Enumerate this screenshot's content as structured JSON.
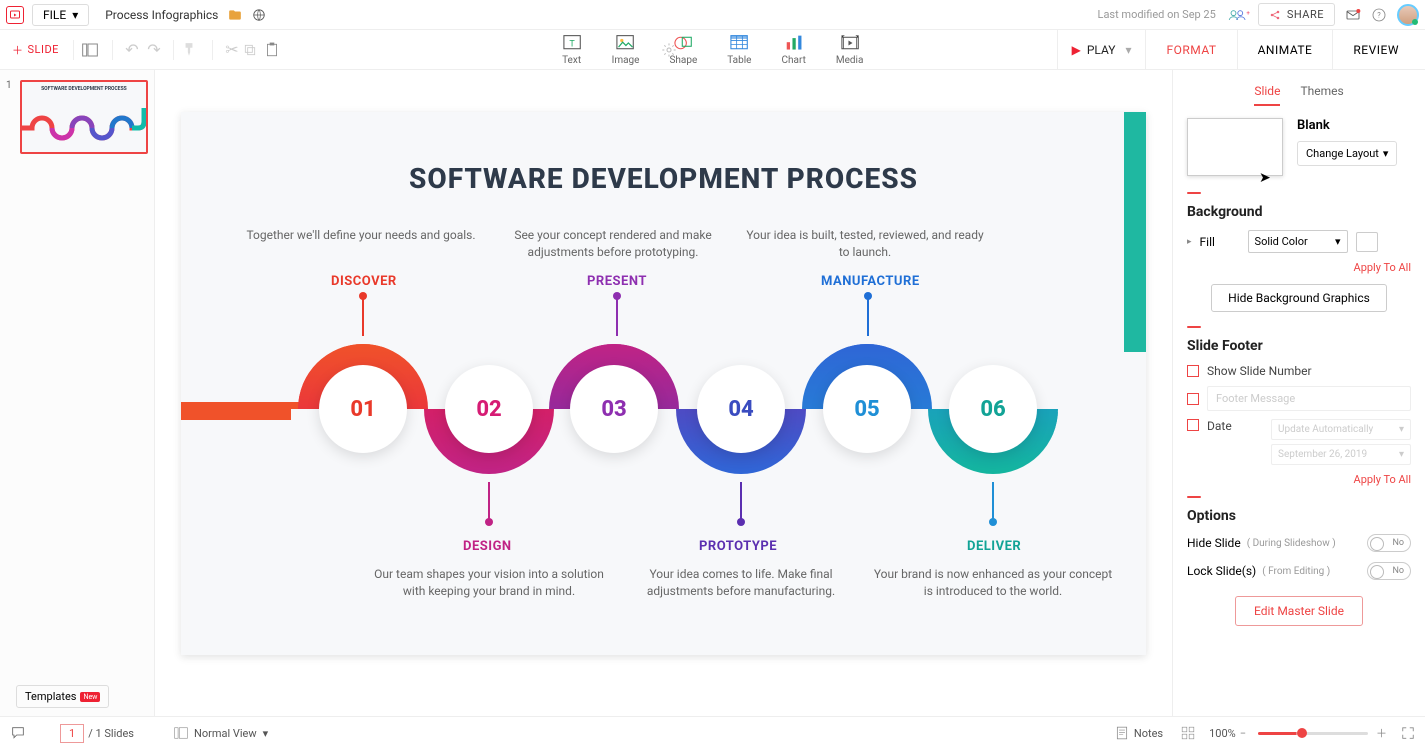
{
  "topbar": {
    "file_label": "FILE",
    "doc_name": "Process Infographics",
    "last_modified": "Last modified on Sep 25",
    "share_label": "SHARE"
  },
  "secondbar": {
    "add_slide": "SLIDE",
    "tools": {
      "text": "Text",
      "image": "Image",
      "shape": "Shape",
      "table": "Table",
      "chart": "Chart",
      "media": "Media"
    },
    "play": "PLAY",
    "tabs": {
      "format": "FORMAT",
      "animate": "ANIMATE",
      "review": "REVIEW"
    }
  },
  "thumbs": {
    "num": "1",
    "templates": "Templates",
    "badge": "New"
  },
  "slide": {
    "title": "SOFTWARE DEVELOPMENT PROCESS",
    "steps": [
      {
        "num": "01",
        "label": "DISCOVER",
        "color": "#e9392a",
        "desc": "Together we'll define your needs and goals."
      },
      {
        "num": "02",
        "label": "DESIGN",
        "color": "#d61c74",
        "desc": "Our team shapes your vision into a solution with keeping your brand in mind."
      },
      {
        "num": "03",
        "label": "PRESENT",
        "color": "#8e2fb0",
        "desc": "See your concept rendered and make adjustments before prototyping."
      },
      {
        "num": "04",
        "label": "PROTOTYPE",
        "color": "#5b2fb0",
        "desc": "Your idea comes to life. Make final adjustments before manufacturing."
      },
      {
        "num": "05",
        "label": "MANUFACTURE",
        "color": "#1f6fd6",
        "desc": "Your idea is built, tested, reviewed, and ready to launch."
      },
      {
        "num": "06",
        "label": "DELIVER",
        "color": "#12a396",
        "desc": "Your brand is now enhanced as your concept is introduced to the world."
      }
    ]
  },
  "panel": {
    "tabs": {
      "slide": "Slide",
      "themes": "Themes"
    },
    "layout_name": "Blank",
    "change_layout": "Change Layout",
    "background": {
      "heading": "Background",
      "fill_label": "Fill",
      "fill_value": "Solid Color",
      "apply_all": "Apply To All",
      "hide_bg": "Hide Background Graphics"
    },
    "footer": {
      "heading": "Slide Footer",
      "show_num": "Show Slide Number",
      "msg_placeholder": "Footer Message",
      "date_label": "Date",
      "update_auto": "Update Automatically",
      "date_value": "September 26, 2019",
      "apply_all": "Apply To All"
    },
    "options": {
      "heading": "Options",
      "hide_slide": "Hide Slide",
      "hide_hint": "( During Slideshow )",
      "lock_slide": "Lock Slide(s)",
      "lock_hint": "( From Editing )",
      "toggle_val": "No"
    },
    "edit_master": "Edit Master Slide"
  },
  "status": {
    "current": "1",
    "total": "/  1 Slides",
    "view": "Normal View",
    "notes": "Notes",
    "zoom": "100%"
  }
}
